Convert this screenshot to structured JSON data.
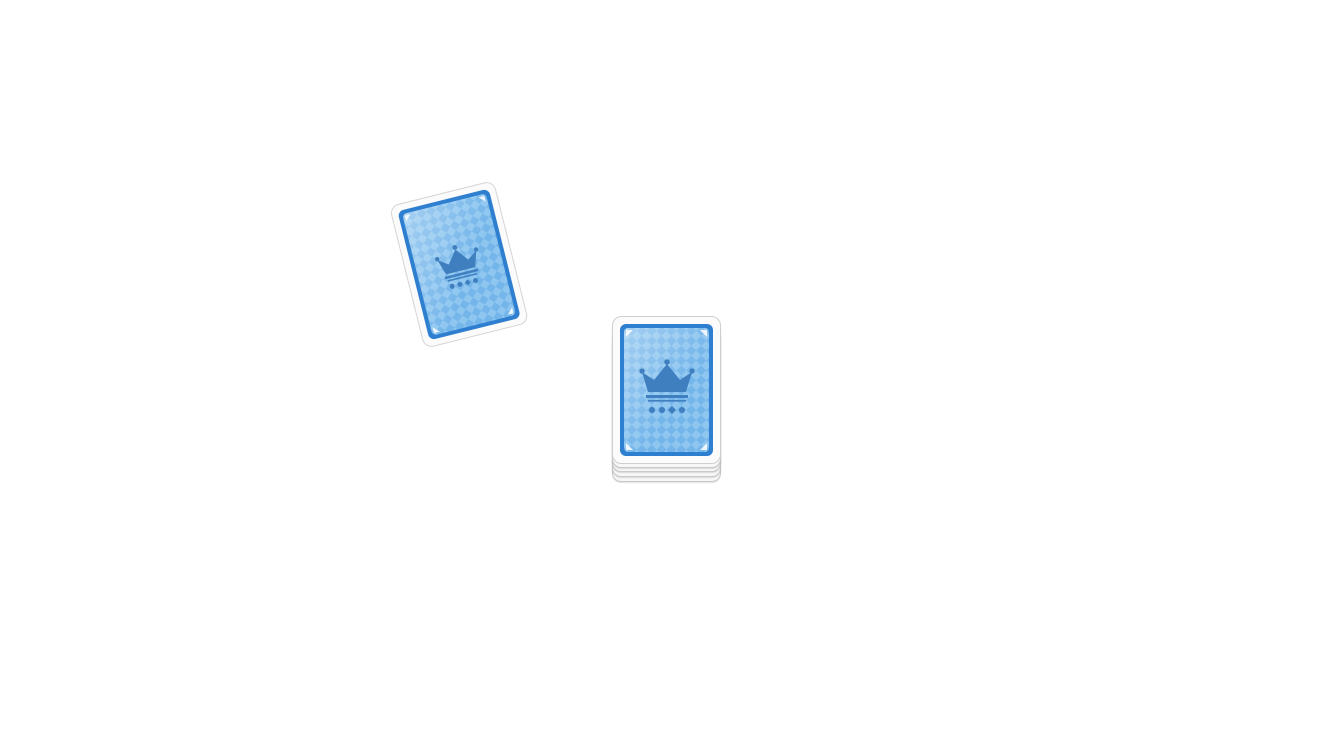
{
  "scene": {
    "background_color": "#ffffff",
    "card_back": {
      "border_color": "#ffffff",
      "frame_color": "#2f7fd0",
      "field_light": "#8ec6f0",
      "field_dark": "#5aa6e4",
      "emblem_color": "#3f7fbf",
      "emblem": "crown-with-suits-icon"
    },
    "deck": {
      "layers_visible": 4
    },
    "flying_card": {
      "rotation_deg": -14
    }
  }
}
